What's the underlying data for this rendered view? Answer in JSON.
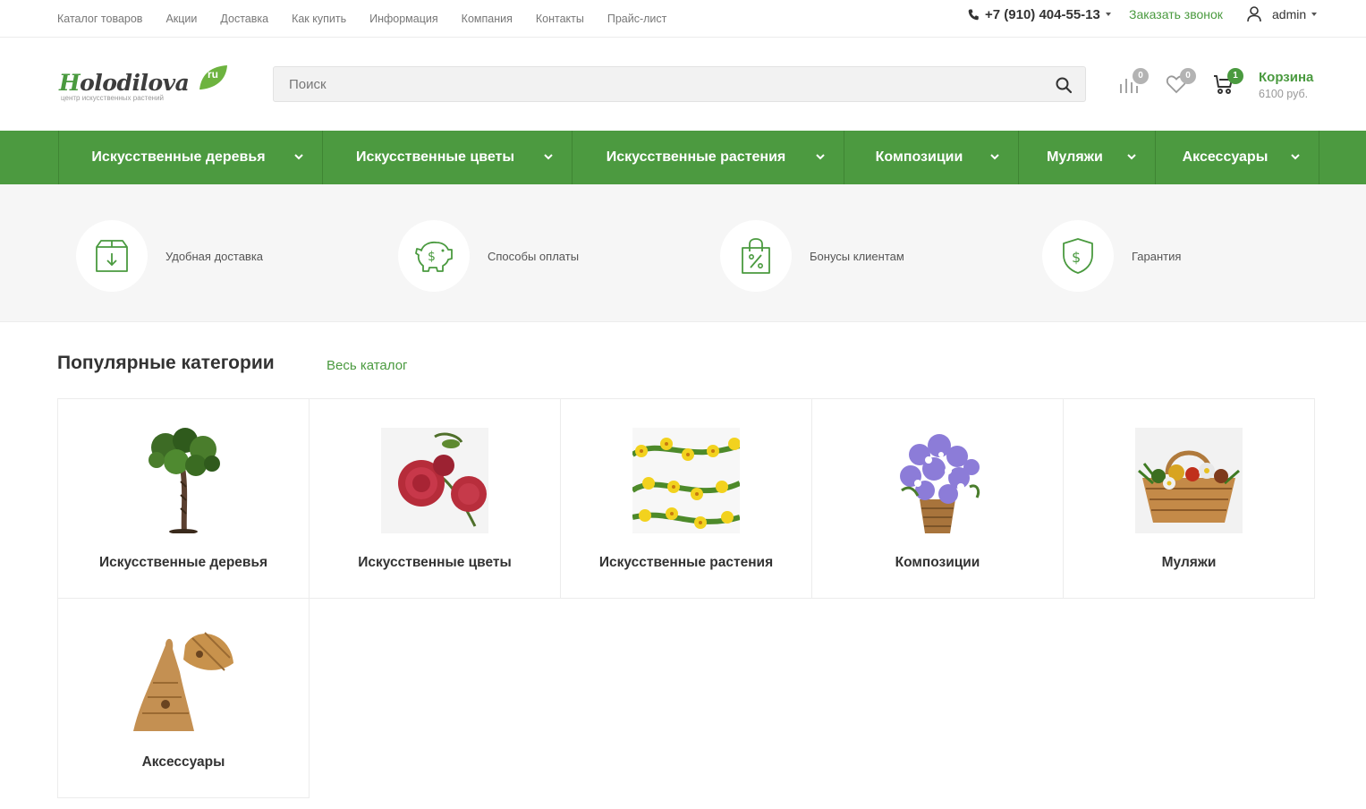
{
  "topbar": {
    "nav": [
      "Каталог товаров",
      "Акции",
      "Доставка",
      "Как купить",
      "Информация",
      "Компания",
      "Контакты",
      "Прайс-лист"
    ],
    "phone": "+7 (910) 404-55-13",
    "callback": "Заказать звонок",
    "user": "admin"
  },
  "header": {
    "logo": {
      "first_letter": "H",
      "rest": "olodilova",
      "tld": "ru",
      "tagline": "центр искусственных растений"
    },
    "search": {
      "placeholder": "Поиск"
    },
    "compare_count": "0",
    "favorites_count": "0",
    "cart": {
      "count": "1",
      "title": "Корзина",
      "sum": "6100 руб."
    }
  },
  "menu": {
    "items": [
      "Искусственные деревья",
      "Искусственные цветы",
      "Искусственные растения",
      "Композиции",
      "Муляжи",
      "Аксессуары"
    ]
  },
  "benefits": [
    {
      "label": "Удобная доставка",
      "icon": "delivery-box-icon"
    },
    {
      "label": "Способы оплаты",
      "icon": "piggy-bank-icon"
    },
    {
      "label": "Бонусы клиентам",
      "icon": "discount-bag-icon"
    },
    {
      "label": "Гарантия",
      "icon": "shield-dollar-icon"
    }
  ],
  "popular": {
    "title": "Популярные категории",
    "all_link": "Весь каталог",
    "categories": [
      {
        "name": "Искусственные деревья",
        "image": "tree-image"
      },
      {
        "name": "Искусственные цветы",
        "image": "flowers-image"
      },
      {
        "name": "Искусственные растения",
        "image": "plants-image"
      },
      {
        "name": "Композиции",
        "image": "composition-image"
      },
      {
        "name": "Муляжи",
        "image": "dummies-image"
      },
      {
        "name": "Аксессуары",
        "image": "accessories-image"
      }
    ]
  },
  "colors": {
    "brand_green": "#4a9a3f",
    "menu_green": "#4c9a40",
    "badge_grey": "#b3b3b3",
    "benefits_bg": "#f6f6f6"
  }
}
